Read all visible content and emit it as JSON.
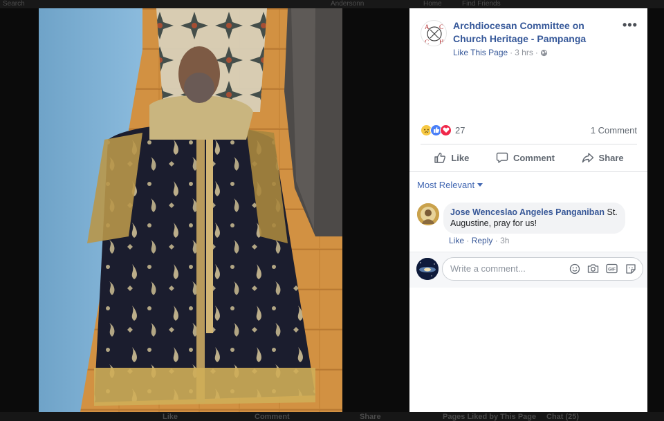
{
  "post": {
    "page_name": "Archdiocesan Committee on Church Heritage - Pampanga",
    "like_page_label": "Like This Page",
    "separator": "·",
    "time": "3 hrs",
    "privacy_icon": "globe-icon",
    "more_label": "•••",
    "avatar_lines": [
      "A",
      "C",
      "C",
      "H"
    ]
  },
  "reactions": {
    "icons": [
      "sad-reaction-icon",
      "like-reaction-icon",
      "love-reaction-icon"
    ],
    "count": "27",
    "comment_count": "1 Comment"
  },
  "actions": [
    {
      "label": "Like",
      "icon": "thumbs-up-icon"
    },
    {
      "label": "Comment",
      "icon": "comment-bubble-icon"
    },
    {
      "label": "Share",
      "icon": "share-arrow-icon"
    }
  ],
  "sort": {
    "label": "Most Relevant",
    "icon": "caret-down-icon"
  },
  "comment": {
    "author": "Jose Wenceslao Angeles Panganiban",
    "text": "St. Augustine, pray for us!",
    "like_label": "Like",
    "reply_label": "Reply",
    "time": "3h"
  },
  "composer": {
    "placeholder": "Write a comment...",
    "tools": [
      "emoji-icon",
      "camera-icon",
      "gif-icon",
      "sticker-icon"
    ]
  },
  "background": {
    "top_ghost": [
      "Search",
      "Andersonn",
      "Home",
      "Find Friends"
    ],
    "bottom_ghost": [
      "Like",
      "Comment",
      "Share",
      "Pages Liked by This Page",
      "Chat (25)"
    ]
  },
  "colors": {
    "link": "#365899",
    "accent": "#4267b2",
    "like_blue": "#4a7ff7",
    "love_red": "#f0284a",
    "sad_yellow": "#f7c945"
  }
}
